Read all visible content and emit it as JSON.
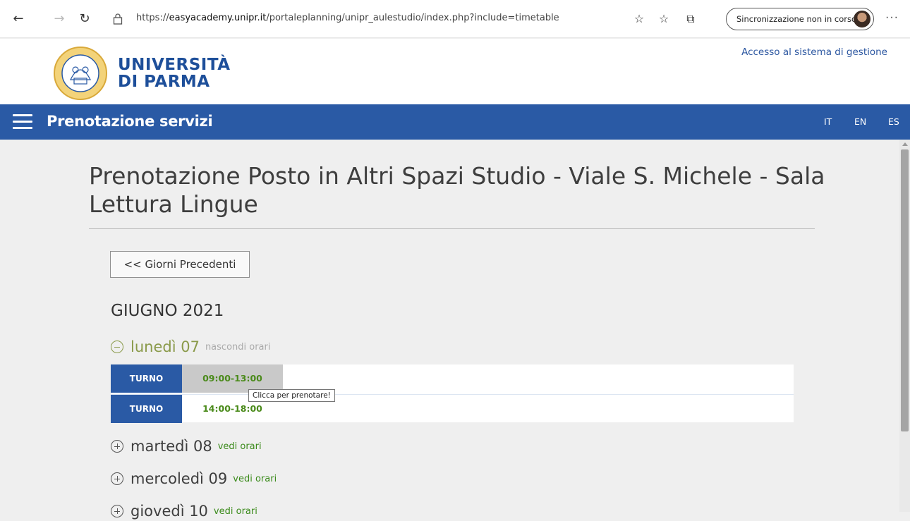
{
  "browser": {
    "url_prefix": "https://",
    "url_domain": "easyacademy.unipr.it",
    "url_path": "/portaleplanning/unipr_aulestudio/index.php?include=timetable",
    "sync_label": "Sincronizzazione non in corso"
  },
  "header": {
    "logo_line1": "UNIVERSITÀ",
    "logo_line2": "DI PARMA",
    "access_link": "Accesso al sistema di gestione"
  },
  "nav": {
    "title": "Prenotazione servizi",
    "languages": [
      "IT",
      "EN",
      "ES"
    ]
  },
  "main": {
    "title": "Prenotazione Posto in Altri Spazi Studio - Viale S. Michele - Sala Lettura Lingue",
    "prev_button": "<< Giorni Precedenti",
    "month": "GIUGNO 2021",
    "days": [
      {
        "name": "lunedì 07",
        "toggle": "nascondi orari",
        "expanded": true
      },
      {
        "name": "martedì 08",
        "toggle": "vedi orari",
        "expanded": false
      },
      {
        "name": "mercoledì 09",
        "toggle": "vedi orari",
        "expanded": false
      },
      {
        "name": "giovedì 10",
        "toggle": "vedi orari",
        "expanded": false
      }
    ],
    "slots": [
      {
        "label": "TURNO",
        "time": "09:00-13:00"
      },
      {
        "label": "TURNO",
        "time": "14:00-18:00"
      }
    ],
    "tooltip": "Clicca per prenotare!"
  },
  "colors": {
    "brand_blue": "#2a5aa5",
    "expanded_day": "#8a9a4a",
    "collapsed_day": "#3e3e3e",
    "link_green": "#3a8a1a",
    "muted_toggle": "#aaaaaa"
  }
}
